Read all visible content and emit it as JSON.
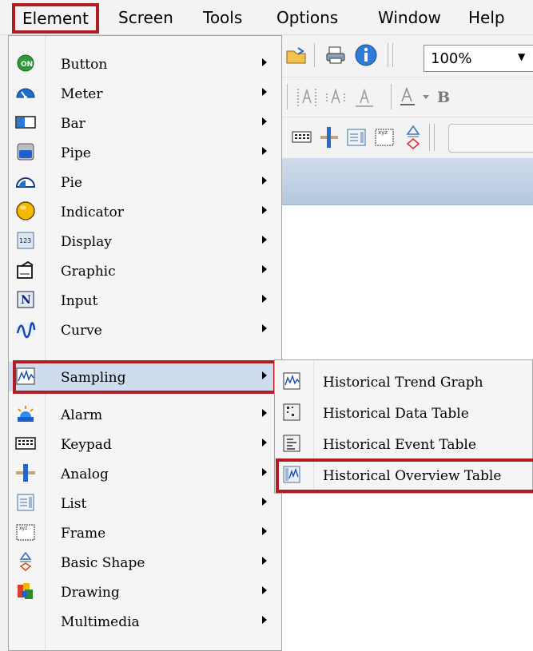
{
  "menubar": {
    "items": [
      "Element",
      "Screen",
      "Tools",
      "Options",
      "Window",
      "Help"
    ]
  },
  "toolbar": {
    "zoom_value": "100%"
  },
  "element_menu": {
    "items": [
      {
        "label": "Button",
        "icon": "on-button-icon"
      },
      {
        "label": "Meter",
        "icon": "meter-icon"
      },
      {
        "label": "Bar",
        "icon": "bar-icon"
      },
      {
        "label": "Pipe",
        "icon": "pipe-icon"
      },
      {
        "label": "Pie",
        "icon": "pie-icon"
      },
      {
        "label": "Indicator",
        "icon": "indicator-icon"
      },
      {
        "label": "Display",
        "icon": "display-123-icon"
      },
      {
        "label": "Graphic",
        "icon": "graphic-icon"
      },
      {
        "label": "Input",
        "icon": "input-n-icon"
      },
      {
        "label": "Curve",
        "icon": "curve-icon"
      },
      {
        "label": "Sampling",
        "icon": "sampling-icon"
      },
      {
        "label": "Alarm",
        "icon": "alarm-icon"
      },
      {
        "label": "Keypad",
        "icon": "keypad-icon"
      },
      {
        "label": "Analog",
        "icon": "analog-icon"
      },
      {
        "label": "List",
        "icon": "list-icon"
      },
      {
        "label": "Frame",
        "icon": "frame-icon"
      },
      {
        "label": "Basic Shape",
        "icon": "basic-shape-icon"
      },
      {
        "label": "Drawing",
        "icon": "drawing-icon"
      },
      {
        "label": "Multimedia",
        "icon": ""
      }
    ]
  },
  "sampling_submenu": {
    "items": [
      {
        "label": "Historical Trend Graph",
        "icon": "trend-graph-icon"
      },
      {
        "label": "Historical Data Table",
        "icon": "data-table-icon"
      },
      {
        "label": "Historical Event Table",
        "icon": "event-table-icon"
      },
      {
        "label": "Historical Overview Table",
        "icon": "overview-table-icon"
      }
    ]
  },
  "colors": {
    "highlight_border": "#b01e23",
    "menu_hover": "#cfdcef",
    "menu_bg": "#f5f5f5"
  }
}
